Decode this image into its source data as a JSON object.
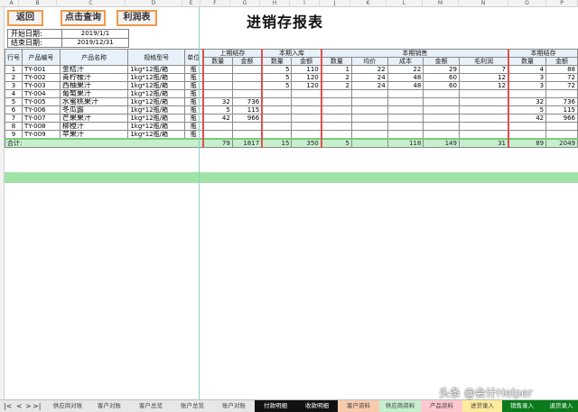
{
  "columns": [
    "A",
    "B",
    "C",
    "D",
    "E",
    "F",
    "G",
    "H",
    "I",
    "J",
    "K",
    "L",
    "M",
    "N",
    "O",
    "P"
  ],
  "buttons": {
    "back": "返回",
    "click_query": "点击查询",
    "profit": "利润表"
  },
  "title": "进销存报表",
  "dates": {
    "start_label": "开始日期:",
    "start_value": "2019/1/1",
    "end_label": "结束日期:",
    "end_value": "2019/12/31"
  },
  "headers": {
    "row_no": "行号",
    "code": "产品编号",
    "name": "产品名称",
    "spec": "规格型号",
    "unit": "单位",
    "prev_stock": "上期结存",
    "inbound": "本期入库",
    "sales": "本期销售",
    "end_stock": "本期结存",
    "qty": "数量",
    "amount": "金额",
    "unit_price": "均价",
    "cost": "成本",
    "gross_profit": "毛利润"
  },
  "rows": [
    {
      "no": "1",
      "code": "TY-001",
      "name": "金桔汁",
      "spec": "1kg*12瓶/箱",
      "unit": "瓶",
      "pq": "",
      "pa": "",
      "iq": "5",
      "ia": "110",
      "sq": "1",
      "sp": "22",
      "sc": "22",
      "sa": "29",
      "sg": "7",
      "eq": "4",
      "ea": "88"
    },
    {
      "no": "2",
      "code": "TY-002",
      "name": "青柠檬汁",
      "spec": "1kg*12瓶/箱",
      "unit": "瓶",
      "pq": "",
      "pa": "",
      "iq": "5",
      "ia": "120",
      "sq": "2",
      "sp": "24",
      "sc": "48",
      "sa": "60",
      "sg": "12",
      "eq": "3",
      "ea": "72"
    },
    {
      "no": "3",
      "code": "TY-003",
      "name": "西柚果汁",
      "spec": "1kg*12瓶/箱",
      "unit": "瓶",
      "pq": "",
      "pa": "",
      "iq": "5",
      "ia": "120",
      "sq": "2",
      "sp": "24",
      "sc": "48",
      "sa": "60",
      "sg": "12",
      "eq": "3",
      "ea": "72"
    },
    {
      "no": "4",
      "code": "TY-004",
      "name": "葡萄果汁",
      "spec": "1kg*12瓶/箱",
      "unit": "瓶",
      "pq": "",
      "pa": "",
      "iq": "",
      "ia": "",
      "sq": "",
      "sp": "",
      "sc": "",
      "sa": "",
      "sg": "",
      "eq": "",
      "ea": ""
    },
    {
      "no": "5",
      "code": "TY-005",
      "name": "水蜜桃果汁",
      "spec": "1kg*12瓶/箱",
      "unit": "瓶",
      "pq": "32",
      "pa": "736",
      "iq": "",
      "ia": "",
      "sq": "",
      "sp": "",
      "sc": "",
      "sa": "",
      "sg": "",
      "eq": "32",
      "ea": "736"
    },
    {
      "no": "6",
      "code": "TY-006",
      "name": "冬瓜露",
      "spec": "1kg*12瓶/箱",
      "unit": "瓶",
      "pq": "5",
      "pa": "115",
      "iq": "",
      "ia": "",
      "sq": "",
      "sp": "",
      "sc": "",
      "sa": "",
      "sg": "",
      "eq": "5",
      "ea": "115"
    },
    {
      "no": "7",
      "code": "TY-007",
      "name": "芒果果汁",
      "spec": "1kg*12瓶/箱",
      "unit": "瓶",
      "pq": "42",
      "pa": "966",
      "iq": "",
      "ia": "",
      "sq": "",
      "sp": "",
      "sc": "",
      "sa": "",
      "sg": "",
      "eq": "42",
      "ea": "966"
    },
    {
      "no": "8",
      "code": "TY-008",
      "name": "柳橙汁",
      "spec": "1kg*12瓶/箱",
      "unit": "瓶",
      "pq": "",
      "pa": "",
      "iq": "",
      "ia": "",
      "sq": "",
      "sp": "",
      "sc": "",
      "sa": "",
      "sg": "",
      "eq": "",
      "ea": ""
    },
    {
      "no": "9",
      "code": "TY-009",
      "name": "苹果汁",
      "spec": "1kg*12瓶/箱",
      "unit": "瓶",
      "pq": "",
      "pa": "",
      "iq": "",
      "ia": "",
      "sq": "",
      "sp": "",
      "sc": "",
      "sa": "",
      "sg": "",
      "eq": "",
      "ea": ""
    }
  ],
  "total": {
    "label": "合计:",
    "pq": "79",
    "pa": "1817",
    "iq": "15",
    "ia": "350",
    "sq": "5",
    "sp": "",
    "sc": "118",
    "sa": "149",
    "sg": "31",
    "eq": "89",
    "ea": "2049"
  },
  "tabs": [
    {
      "label": "供应商对账",
      "style": ""
    },
    {
      "label": "客户对账",
      "style": ""
    },
    {
      "label": "客户总览",
      "style": ""
    },
    {
      "label": "账户总览",
      "style": ""
    },
    {
      "label": "账户对账",
      "style": ""
    },
    {
      "label": "付款明细",
      "style": "dark"
    },
    {
      "label": "收款明细",
      "style": "dark"
    },
    {
      "label": "客户资料",
      "style": "orange"
    },
    {
      "label": "供应商资料",
      "style": "green"
    },
    {
      "label": "产品资料",
      "style": "pink"
    },
    {
      "label": "进货录入",
      "style": "yellow"
    },
    {
      "label": "销售录入",
      "style": "dkgreen"
    },
    {
      "label": "退货录入",
      "style": "dkgreen"
    }
  ],
  "tab_nav": {
    "first": "|<",
    "prev": "<",
    "next": ">",
    "last": ">|"
  },
  "watermark": "头条 @会计Helper"
}
